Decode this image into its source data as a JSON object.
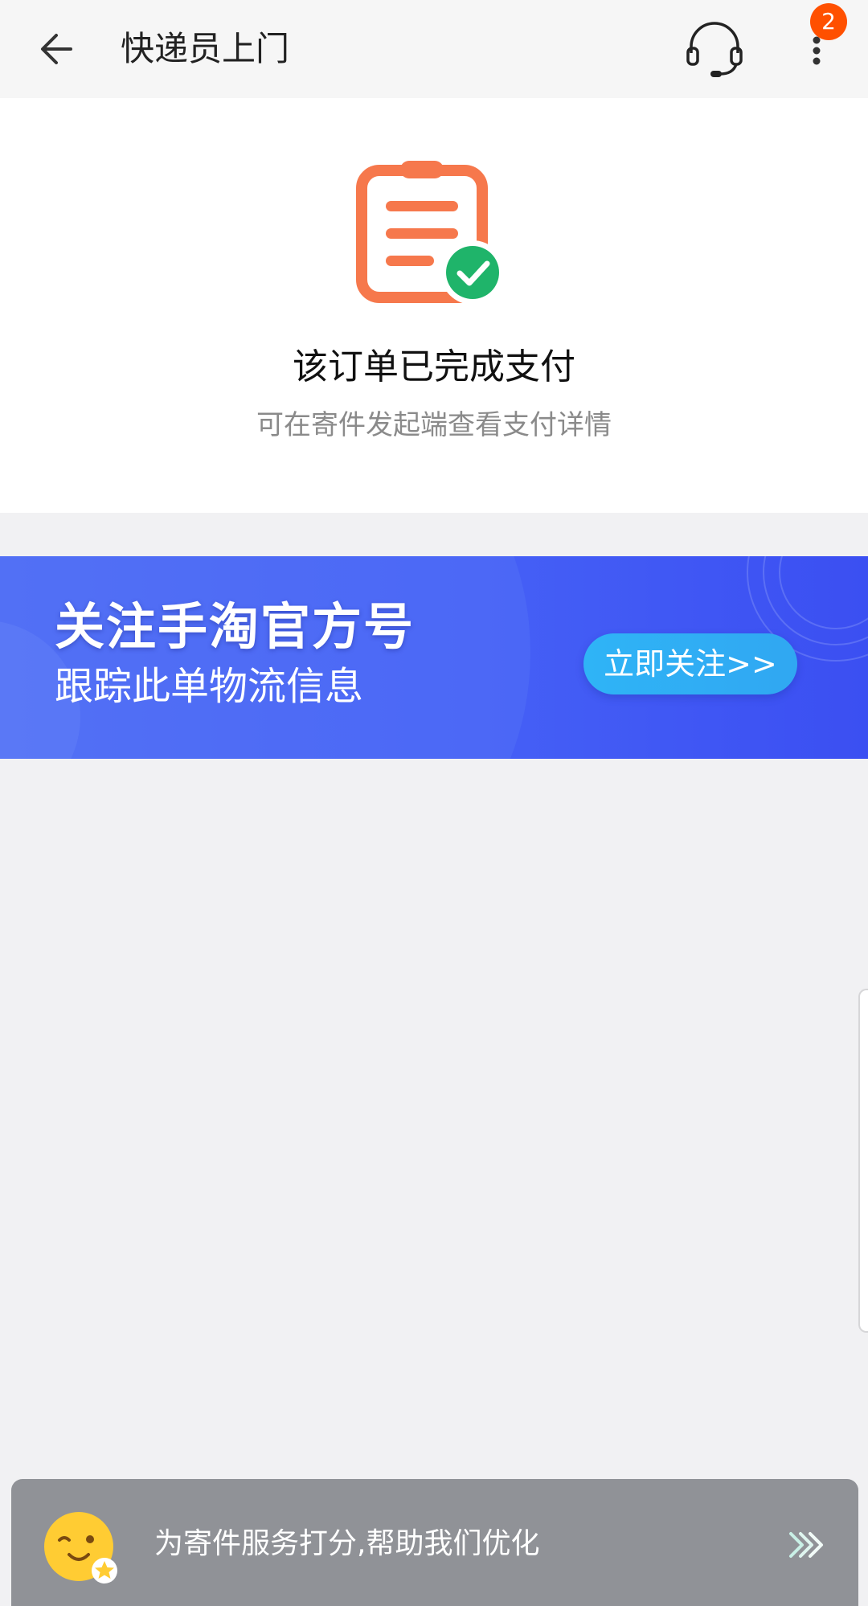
{
  "header": {
    "title": "快递员上门",
    "badge_count": "2",
    "icons": {
      "back": "back-arrow-icon",
      "customer_service": "headset-icon",
      "more": "more-vertical-icon"
    }
  },
  "status": {
    "title": "该订单已完成支付",
    "subtitle": "可在寄件发起端查看支付详情",
    "icon": "clipboard-check-icon"
  },
  "banner": {
    "title": "关注手淘官方号",
    "subtitle": "跟踪此单物流信息",
    "button_label": "立即关注>>"
  },
  "rating": {
    "text": "为寄件服务打分,帮助我们优化",
    "icons": {
      "face": "smiley-face-icon",
      "arrow": "triple-chevron-right-icon"
    }
  },
  "colors": {
    "accent_orange": "#ff5000",
    "icon_orange": "#f6784c",
    "success_green": "#1fb46a",
    "banner_blue": "#4560f6",
    "button_cyan": "#2fb4f6",
    "rating_bar_gray": "#909297"
  }
}
